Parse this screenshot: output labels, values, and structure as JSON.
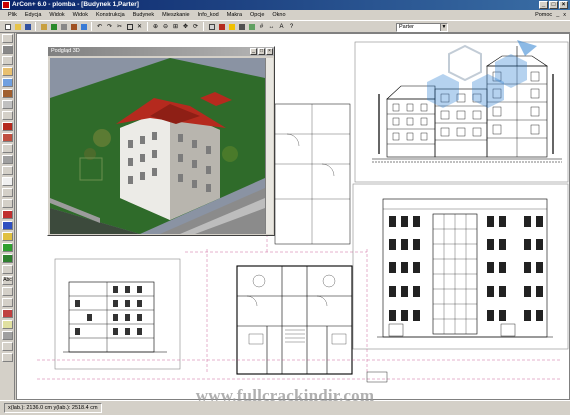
{
  "window": {
    "title": "ArCon+ 6.0 - plomba - [Budynek 1,Parter]"
  },
  "menu": {
    "items": [
      "Plik",
      "Edycja",
      "Widok",
      "Widok",
      "Konstrukcja",
      "Budynek",
      "Mieszkanie",
      "Info_kod",
      "Makra",
      "Opcje",
      "Okno"
    ],
    "right_items": [
      "Pomoc",
      "_",
      "x"
    ]
  },
  "toolbar": {
    "floor_select": "Parter"
  },
  "preview_window": {
    "title": "Podgląd 3D"
  },
  "status": {
    "coords": "x(lab.): 2136.0 cm   y(lab.): 2518.4 cm"
  },
  "watermark": {
    "text": "www.fullcrackindir.com"
  },
  "colors": {
    "titlebar": "#0a246a",
    "chrome": "#d4d0c8",
    "roof": "#b52a1e",
    "lawn": "#2f6b2a",
    "accent_logo": "#2b7fd0"
  }
}
